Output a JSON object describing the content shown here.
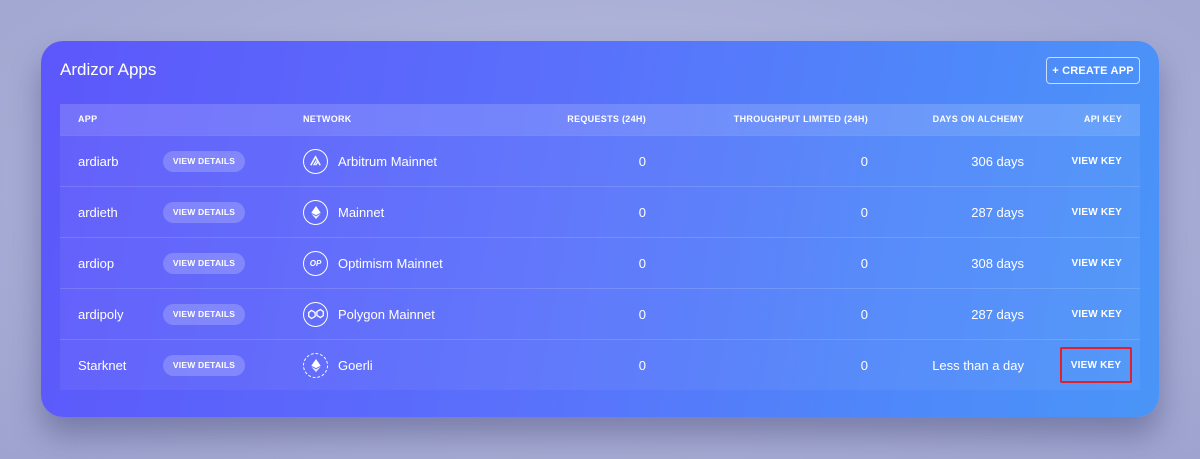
{
  "card": {
    "title": "Ardizor Apps",
    "create_button": "+ CREATE APP"
  },
  "table": {
    "headers": {
      "app": "APP",
      "network": "NETWORK",
      "requests": "REQUESTS (24H)",
      "throughput": "THROUGHPUT LIMITED (24H)",
      "days": "DAYS ON ALCHEMY",
      "api_key": "API KEY"
    },
    "rows": [
      {
        "app": "ardiarb",
        "details": "VIEW DETAILS",
        "network": "Arbitrum Mainnet",
        "network_icon": "arbitrum-icon",
        "requests": "0",
        "throughput": "0",
        "days": "306 days",
        "key": "VIEW KEY"
      },
      {
        "app": "ardieth",
        "details": "VIEW DETAILS",
        "network": "Mainnet",
        "network_icon": "ethereum-icon",
        "requests": "0",
        "throughput": "0",
        "days": "287 days",
        "key": "VIEW KEY"
      },
      {
        "app": "ardiop",
        "details": "VIEW DETAILS",
        "network": "Optimism Mainnet",
        "network_icon": "optimism-icon",
        "network_icon_text": "OP",
        "requests": "0",
        "throughput": "0",
        "days": "308 days",
        "key": "VIEW KEY"
      },
      {
        "app": "ardipoly",
        "details": "VIEW DETAILS",
        "network": "Polygon Mainnet",
        "network_icon": "polygon-icon",
        "requests": "0",
        "throughput": "0",
        "days": "287 days",
        "key": "VIEW KEY"
      },
      {
        "app": "Starknet",
        "details": "VIEW DETAILS",
        "network": "Goerli",
        "network_icon": "ethereum-testnet-icon",
        "requests": "0",
        "throughput": "0",
        "days": "Less than a day",
        "key": "VIEW KEY",
        "highlighted": true
      }
    ]
  },
  "colors": {
    "highlight": "#e0202a",
    "card_start": "#5c57fb",
    "card_end": "#4a95f8"
  }
}
